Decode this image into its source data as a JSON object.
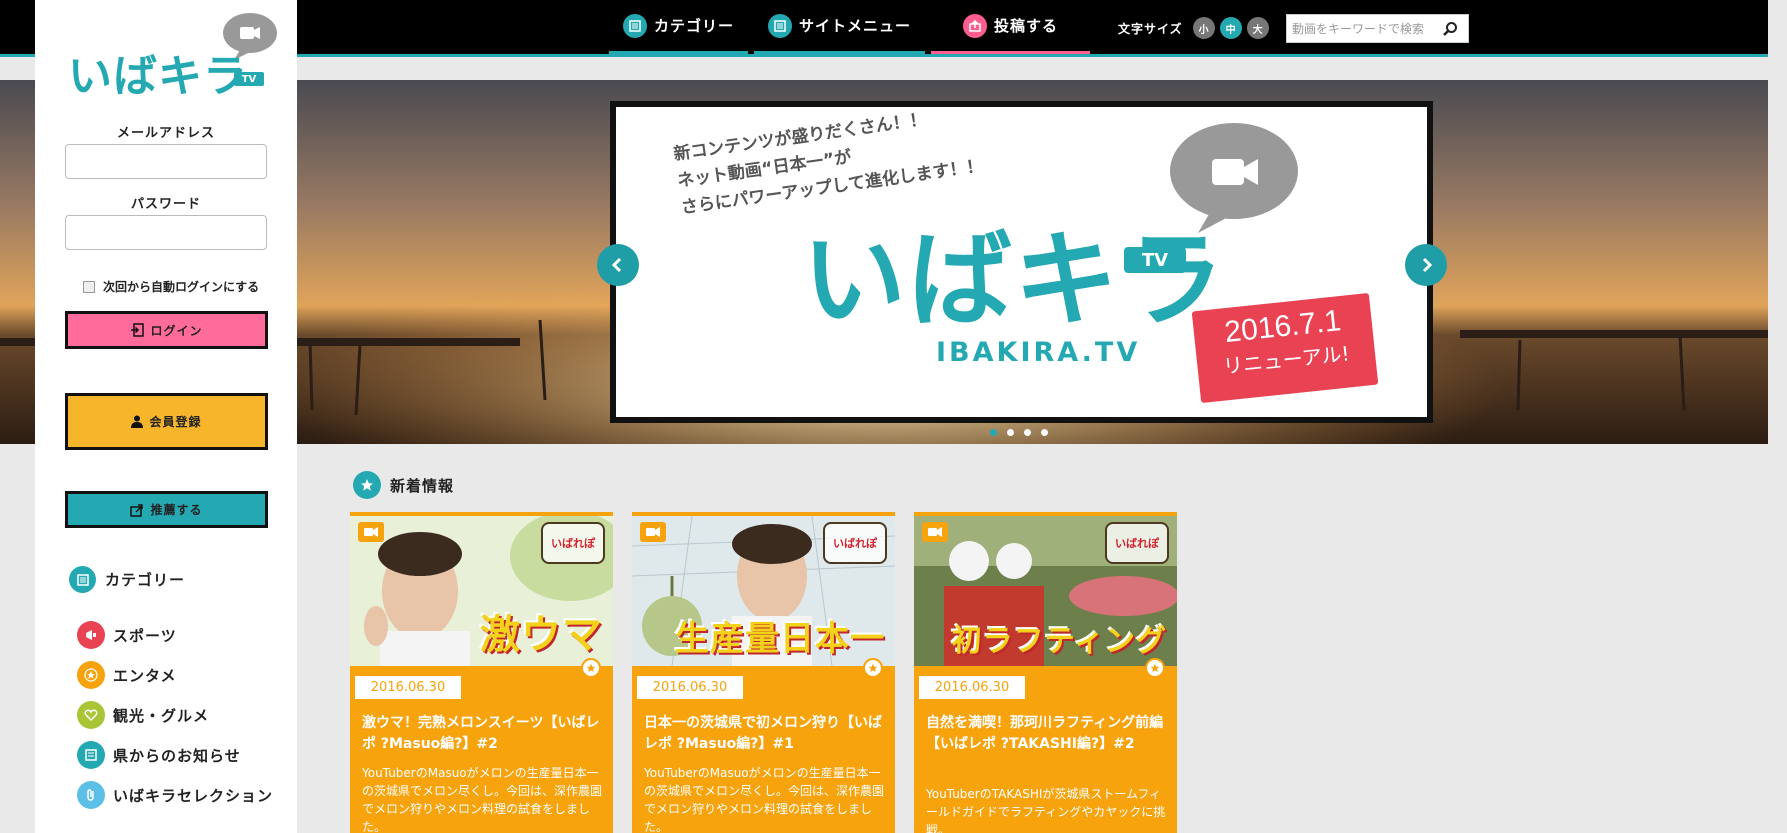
{
  "nav": {
    "category": "カテゴリー",
    "site_menu": "サイトメニュー",
    "post": "投稿する",
    "font_size_label": "文字サイズ",
    "font_sizes": [
      "小",
      "中",
      "大"
    ],
    "active_font_size": "中"
  },
  "search": {
    "placeholder": "動画をキーワードで検索"
  },
  "sidebar": {
    "logo_text": "いばキラ",
    "logo_sub": "TV",
    "email_label": "メールアドレス",
    "password_label": "パスワード",
    "remember_label": "次回から自動ログインにする",
    "login_button": "ログイン",
    "register_button": "会員登録",
    "recommend_button": "推薦する",
    "category_heading": "カテゴリー",
    "categories": [
      {
        "label": "スポーツ",
        "color": "#e84253",
        "icon": "megaphone-icon"
      },
      {
        "label": "エンタメ",
        "color": "#f6a30e",
        "icon": "star-icon"
      },
      {
        "label": "観光・グルメ",
        "color": "#a7c535",
        "icon": "heart-icon"
      },
      {
        "label": "県からのお知らせ",
        "color": "#24a9b2",
        "icon": "document-icon"
      },
      {
        "label": "いばキラセレクション",
        "color": "#5bbfe6",
        "icon": "clip-icon"
      }
    ]
  },
  "hero": {
    "tagline": [
      "新コンテンツが盛りだくさん！！",
      "ネット動画“日本一”が",
      "さらにパワーアップして進化します！！"
    ],
    "logo_text": "いばキラ",
    "logo_sub": "TV",
    "domain": "IBAKIRA.TV",
    "stamp_date": "2016.7.1",
    "stamp_text": "リニューアル!",
    "slide_count": 4,
    "active_slide": 1
  },
  "news": {
    "heading": "新着情報",
    "items": [
      {
        "thumb_text": "激ウマ",
        "badge": "いばれぽ",
        "date": "2016.06.30",
        "title": "激ウマ！完熟メロンスイーツ【いばレポ ?Masuo編?】#2",
        "desc": "YouTuberのMasuoがメロンの生産量日本一の茨城県でメロン尽くし。今回は、深作農園でメロン狩りやメロン料理の試食をしました。"
      },
      {
        "thumb_text": "生産量日本一",
        "badge": "いばれぽ",
        "date": "2016.06.30",
        "title": "日本一の茨城県で初メロン狩り【いばレポ ?Masuo編?】#1",
        "desc": "YouTuberのMasuoがメロンの生産量日本一の茨城県でメロン尽くし。今回は、深作農園でメロン狩りやメロン料理の試食をしました。"
      },
      {
        "thumb_text": "初ラフティング",
        "badge": "いばれぽ",
        "date": "2016.06.30",
        "title": "自然を満喫！那珂川ラフティング前編【いばレポ ?TAKASHI編?】#2",
        "desc": "YouTuberのTAKASHIが茨城県ストームフィールドガイドでラフティングやカヤックに挑戦。"
      }
    ]
  },
  "colors": {
    "teal": "#24a9b2",
    "pink": "#ff6b9a",
    "yellow": "#f7b52c",
    "orange": "#f6a30e"
  }
}
